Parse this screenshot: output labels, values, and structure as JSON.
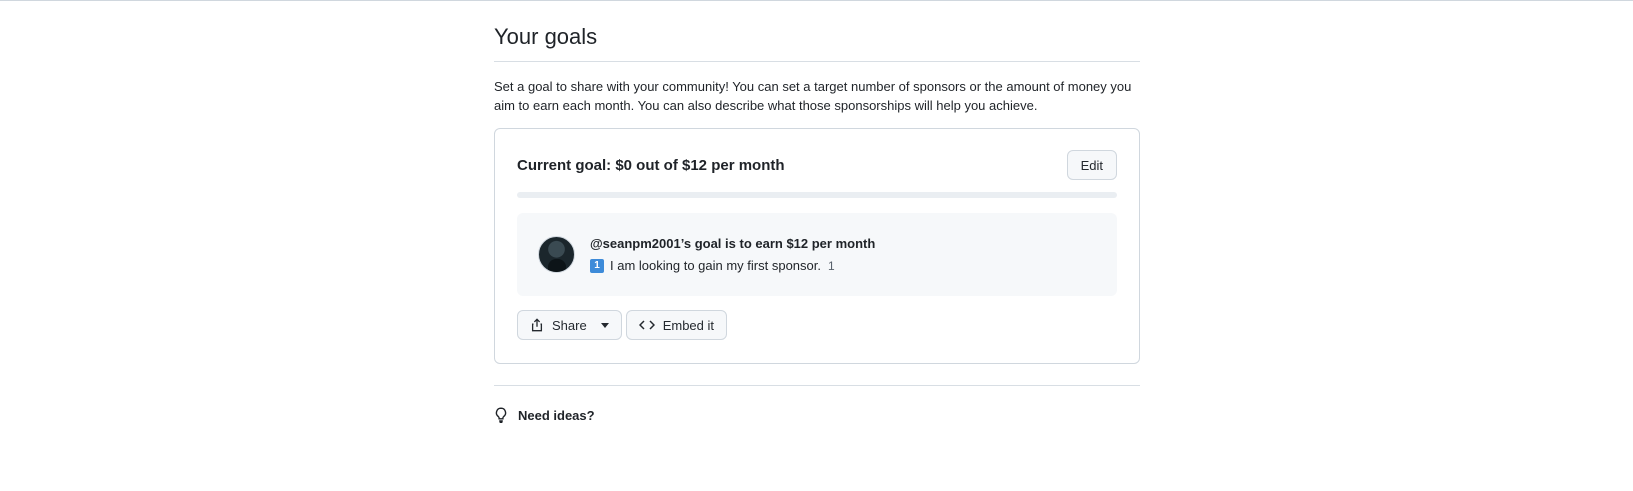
{
  "page": {
    "title": "Your goals",
    "description": "Set a goal to share with your community! You can set a target number of sponsors or the amount of money you aim to earn each month. You can also describe what those sponsorships will help you achieve."
  },
  "goal": {
    "title": "Current goal: $0 out of $12 per month",
    "edit_label": "Edit",
    "progress_percent": 0,
    "accent_color": "#bf3989",
    "card": {
      "heading": "@seanpm2001’s goal is to earn $12 per month",
      "emoji": "1",
      "text": "I am looking to gain my first sponsor.",
      "count": "1"
    },
    "actions": {
      "share_label": "Share",
      "embed_label": "Embed it"
    }
  },
  "ideas": {
    "label": "Need ideas?"
  },
  "icons": {
    "share": "share-icon",
    "embed": "code-icon",
    "ideas": "light-bulb-icon"
  }
}
